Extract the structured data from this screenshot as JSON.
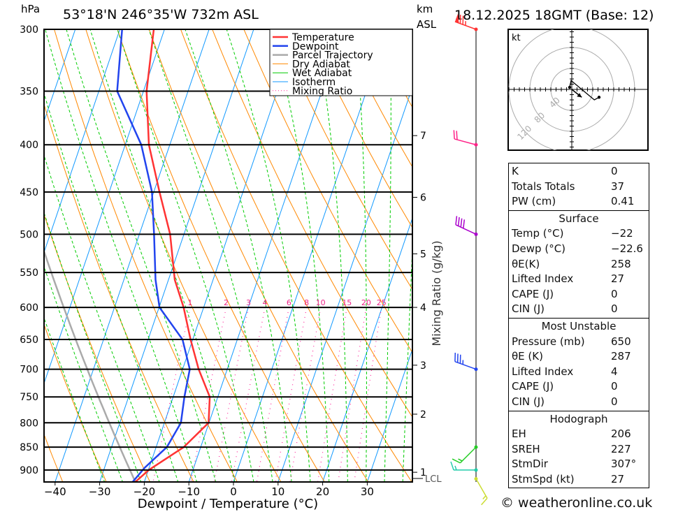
{
  "header": {
    "pressure_unit": "hPa",
    "location": "53°18'N  246°35'W  732m  ASL",
    "km_label": "km",
    "asl_label": "ASL",
    "datetime": "18.12.2025  18GMT  (Base: 12)"
  },
  "chart_data": {
    "type": "line",
    "title": "",
    "xlabel": "Dewpoint / Temperature (°C)",
    "ylabel": "hPa",
    "secondary_label": "Mixing Ratio (g/kg)",
    "ylim": [
      927,
      300
    ],
    "y_scale": "log",
    "xlim": [
      -40,
      30
    ],
    "x_ticks": [
      -40,
      -30,
      -20,
      -10,
      0,
      10,
      20,
      30
    ],
    "pressure_ticks": [
      300,
      350,
      400,
      450,
      500,
      550,
      600,
      650,
      700,
      750,
      800,
      850,
      900
    ],
    "km_ticks": [
      {
        "km": "1",
        "p": 905
      },
      {
        "km": "2",
        "p": 783
      },
      {
        "km": "3",
        "p": 693
      },
      {
        "km": "4",
        "p": 600
      },
      {
        "km": "5",
        "p": 525
      },
      {
        "km": "6",
        "p": 456
      },
      {
        "km": "7",
        "p": 391
      }
    ],
    "lcl_label": "LCL",
    "mixing_ratio_labels": [
      "1",
      "2",
      "3",
      "4",
      "6",
      "8",
      "10",
      "15",
      "20",
      "25"
    ],
    "legend": [
      "Temperature",
      "Dewpoint",
      "Parcel Trajectory",
      "Dry Adiabat",
      "Wet Adiabat",
      "Isotherm",
      "Mixing Ratio"
    ],
    "legend_position": "top-right",
    "colors": {
      "temperature": "#ff3333",
      "dewpoint": "#2244ee",
      "parcel": "#aaaaaa",
      "dry": "#ff8800",
      "wet": "#00cc00",
      "isotherm": "#1199ff",
      "mixing": "#ff2299"
    },
    "series": [
      {
        "name": "Temperature",
        "p": [
          927,
          900,
          850,
          800,
          750,
          700,
          650,
          600,
          560,
          500,
          450,
          400,
          350,
          300
        ],
        "t": [
          -22,
          -19.9,
          -13.8,
          -10.1,
          -11.8,
          -16.4,
          -20.5,
          -24.5,
          -28.6,
          -33.1,
          -38.7,
          -44.7,
          -49.3,
          -52.4
        ]
      },
      {
        "name": "Dewpoint",
        "p": [
          927,
          895,
          850,
          800,
          750,
          700,
          650,
          600,
          560,
          500,
          450,
          400,
          350,
          300
        ],
        "t": [
          -22.6,
          -21,
          -17.6,
          -16.3,
          -17.5,
          -18.4,
          -22.3,
          -29.9,
          -32.9,
          -36.7,
          -40.4,
          -46.4,
          -55.9,
          -59.5
        ]
      },
      {
        "name": "Parcel Trajectory",
        "p_start": 927,
        "t_start": -22
      }
    ],
    "winds": [
      {
        "p": 300,
        "dir": 290,
        "spd": 75,
        "color": "#ff3333"
      },
      {
        "p": 400,
        "dir": 285,
        "spd": 20,
        "color": "#ff2288"
      },
      {
        "p": 500,
        "dir": 295,
        "spd": 40,
        "color": "#aa00cc"
      },
      {
        "p": 700,
        "dir": 290,
        "spd": 35,
        "color": "#2244ee"
      },
      {
        "p": 850,
        "dir": 225,
        "spd": 15,
        "color": "#22cc22"
      },
      {
        "p": 900,
        "dir": 270,
        "spd": 15,
        "color": "#22ccaa"
      },
      {
        "p": 920,
        "dir": 150,
        "spd": 15,
        "color": "#ccdd33"
      }
    ]
  },
  "hodograph": {
    "unit_label": "kt",
    "ring_labels": [
      "40",
      "80",
      "120"
    ],
    "points_uv": [
      [
        -4,
        4
      ],
      [
        -1.3,
        17
      ],
      [
        43,
        -20
      ],
      [
        52,
        -15
      ]
    ],
    "storm_uv": [
      19,
      -15
    ]
  },
  "indices": {
    "top": [
      {
        "k": "K",
        "v": "0"
      },
      {
        "k": "Totals Totals",
        "v": "37"
      },
      {
        "k": "PW (cm)",
        "v": "0.41"
      }
    ],
    "surface": {
      "title": "Surface",
      "rows": [
        {
          "k": "Temp (°C)",
          "v": "−22"
        },
        {
          "k": "Dewp (°C)",
          "v": "−22.6"
        },
        {
          "k": "θE(K)",
          "v": "258"
        },
        {
          "k": "Lifted Index",
          "v": "27"
        },
        {
          "k": "CAPE (J)",
          "v": "0"
        },
        {
          "k": "CIN (J)",
          "v": "0"
        }
      ]
    },
    "most_unstable": {
      "title": "Most Unstable",
      "rows": [
        {
          "k": "Pressure (mb)",
          "v": "650"
        },
        {
          "k": "θE (K)",
          "v": "287"
        },
        {
          "k": "Lifted Index",
          "v": "4"
        },
        {
          "k": "CAPE (J)",
          "v": "0"
        },
        {
          "k": "CIN (J)",
          "v": "0"
        }
      ]
    },
    "hodograph": {
      "title": "Hodograph",
      "rows": [
        {
          "k": "EH",
          "v": "206"
        },
        {
          "k": "SREH",
          "v": "227"
        },
        {
          "k": "StmDir",
          "v": "307°"
        },
        {
          "k": "StmSpd (kt)",
          "v": "27"
        }
      ]
    }
  },
  "footer": {
    "copyright": "© weatheronline.co.uk"
  }
}
